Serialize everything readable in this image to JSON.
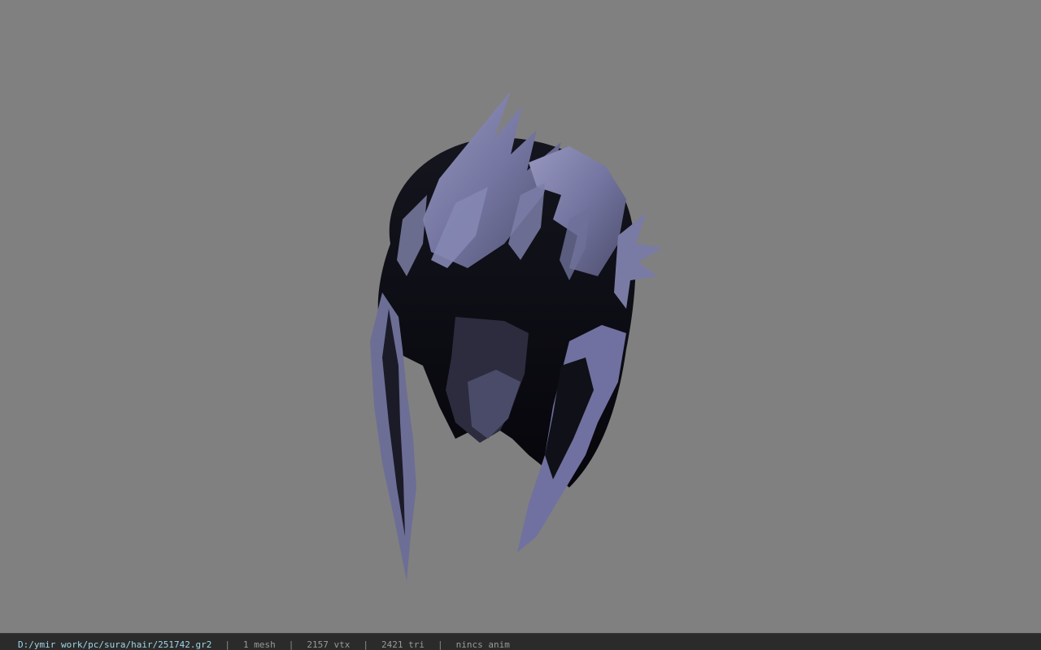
{
  "viewport": {
    "background_color": "#808080",
    "model": {
      "icon": "hair-mesh-model",
      "shade_light": "#8a8bb0",
      "shade_mid": "#5a5b7d",
      "shade_dark": "#0a0a12"
    }
  },
  "status_bar": {
    "file_path": "D:/ymir work/pc/sura/hair/251742.gr2",
    "separator": "|",
    "mesh_count": "1 mesh",
    "vertex_count": "2157 vtx",
    "triangle_count": "2421 tri",
    "anim_status": "nincs anim",
    "path_color": "#9fd6e6",
    "text_color": "#9a9a9a"
  }
}
